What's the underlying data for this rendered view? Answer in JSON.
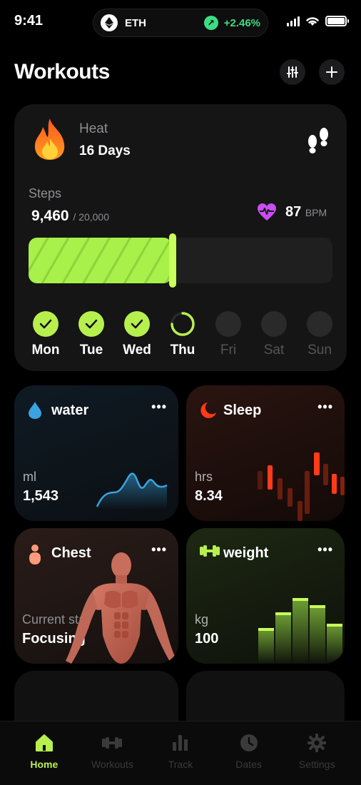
{
  "status": {
    "time": "9:41",
    "ticker": "ETH",
    "change": "+2.46%"
  },
  "header": {
    "title": "Workouts"
  },
  "heat": {
    "label": "Heat",
    "value": "16 Days",
    "steps_label": "Steps",
    "steps_value": "9,460",
    "steps_goal": "/ 20,000",
    "steps_progress": 0.473,
    "bpm_value": "87",
    "bpm_unit": "BPM",
    "days": [
      {
        "label": "Mon",
        "state": "done"
      },
      {
        "label": "Tue",
        "state": "done"
      },
      {
        "label": "Wed",
        "state": "done"
      },
      {
        "label": "Thu",
        "state": "current"
      },
      {
        "label": "Fri",
        "state": "future"
      },
      {
        "label": "Sat",
        "state": "future"
      },
      {
        "label": "Sun",
        "state": "future"
      }
    ]
  },
  "tiles": {
    "water": {
      "title": "water",
      "unit": "ml",
      "value": "1,543"
    },
    "sleep": {
      "title": "Sleep",
      "unit": "hrs",
      "value": "8.34"
    },
    "chest": {
      "title": "Chest",
      "unit": "Current sta",
      "value": "Focusing"
    },
    "weight": {
      "title": "weight",
      "unit": "kg",
      "value": "100"
    }
  },
  "tabbar": {
    "items": [
      {
        "label": "Home",
        "icon": "home-icon",
        "active": true
      },
      {
        "label": "Workouts",
        "icon": "dumbbell-icon",
        "active": false
      },
      {
        "label": "Track",
        "icon": "bar-chart-icon",
        "active": false
      },
      {
        "label": "Dates",
        "icon": "clock-icon",
        "active": false
      },
      {
        "label": "Settings",
        "icon": "gear-icon",
        "active": false
      }
    ]
  },
  "colors": {
    "accent": "#b7f04e",
    "positive": "#3ddc84",
    "heart": "#c94ef0",
    "water": "#3aa3e0",
    "sleep": "#ff3b1a"
  }
}
